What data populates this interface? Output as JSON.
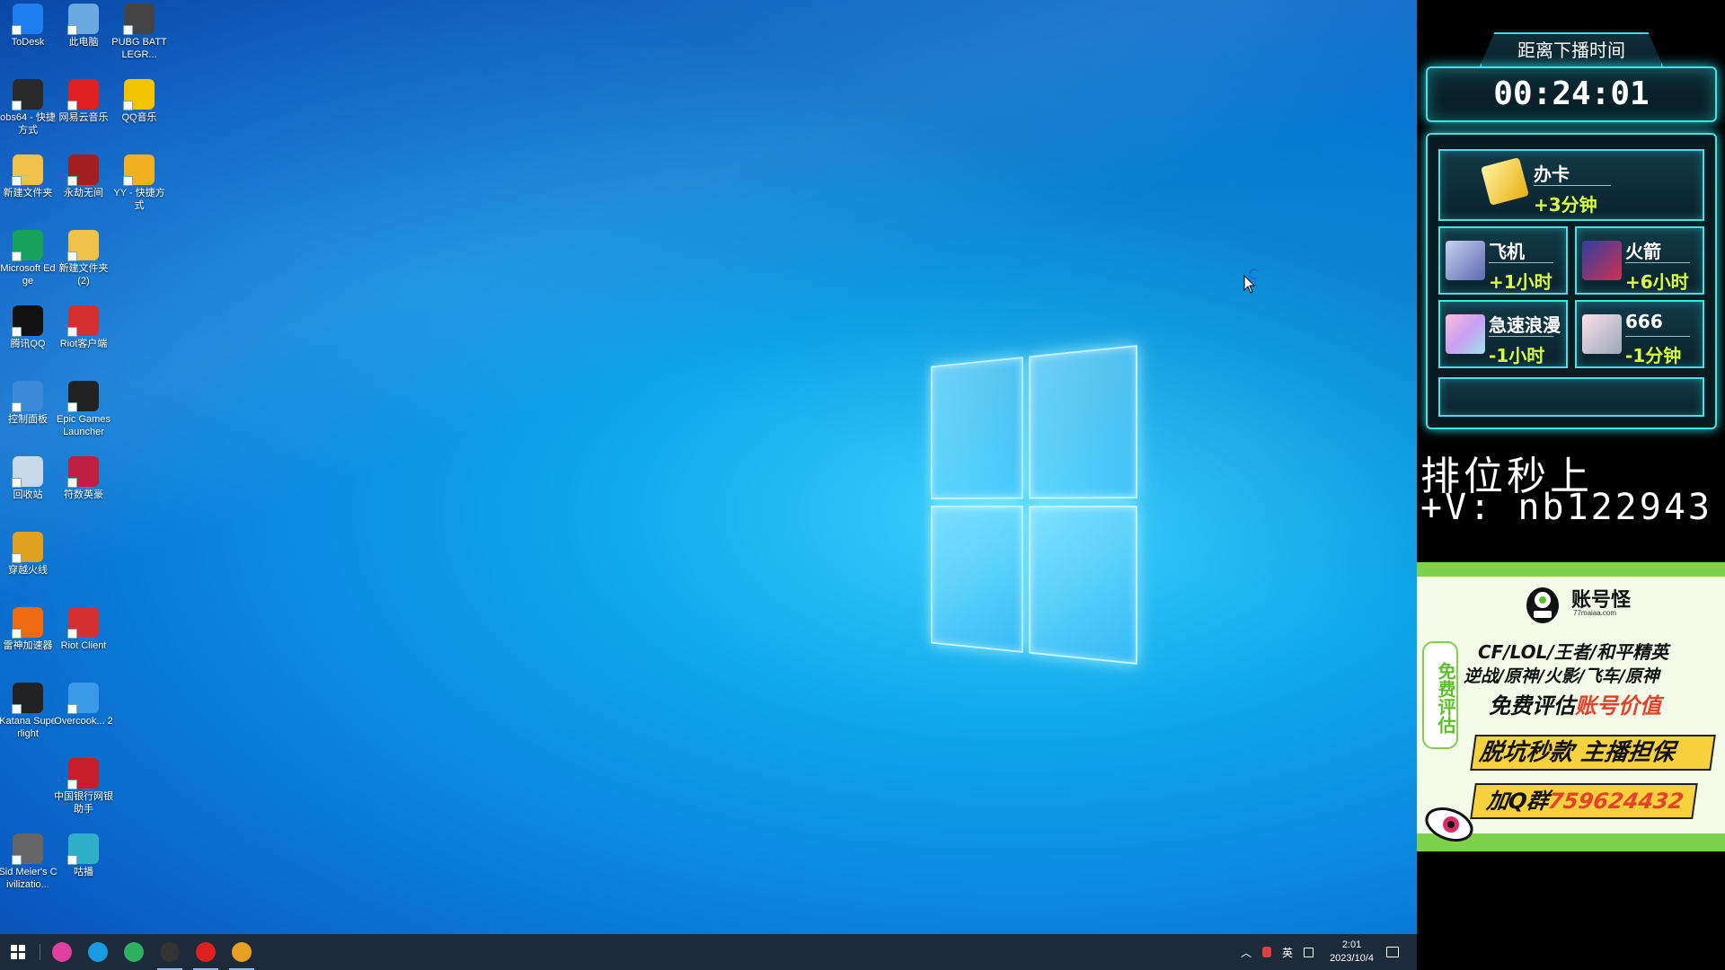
{
  "desktop": {
    "icons": [
      {
        "label": "ToDesk",
        "color": "#1e7ef0"
      },
      {
        "label": "此电脑",
        "color": "#6aa8e0"
      },
      {
        "label": "PUBG BATTLEGR...",
        "color": "#444444"
      },
      {
        "label": "obs64 - 快捷方式",
        "color": "#2a2a2a"
      },
      {
        "label": "网易云音乐",
        "color": "#e02020"
      },
      {
        "label": "QQ音乐",
        "color": "#f5c400"
      },
      {
        "label": "新建文件夹",
        "color": "#f0c24a"
      },
      {
        "label": "永劫无间",
        "color": "#a02020"
      },
      {
        "label": "YY - 快捷方式",
        "color": "#f0b020"
      },
      {
        "label": "Microsoft Edge",
        "color": "#19a35a"
      },
      {
        "label": "新建文件夹 (2)",
        "color": "#f0c24a"
      },
      {
        "label": "腾讯QQ",
        "color": "#111111"
      },
      {
        "label": "Riot客户端",
        "color": "#d43030"
      },
      {
        "label": "控制面板",
        "color": "#3a8ad8"
      },
      {
        "label": "Epic Games Launcher",
        "color": "#222222"
      },
      {
        "label": "回收站",
        "color": "#c8d8e8"
      },
      {
        "label": "符数英豪",
        "color": "#c02040"
      },
      {
        "label": "穿越火线",
        "color": "#e0a020"
      },
      {
        "label": "雷神加速器",
        "color": "#f06a10"
      },
      {
        "label": "Riot Client",
        "color": "#d43030"
      },
      {
        "label": "Katana Superlight",
        "color": "#222222"
      },
      {
        "label": "Overcook... 2",
        "color": "#3a9ae8"
      },
      {
        "label": "中国银行网银助手",
        "color": "#c81e2a"
      },
      {
        "label": "Sid Meier's Civilizatio...",
        "color": "#666666"
      },
      {
        "label": "咕播",
        "color": "#30b0c8"
      }
    ]
  },
  "taskbar": {
    "apps": [
      {
        "name": "color-circle-app-icon",
        "color": "#e040a0"
      },
      {
        "name": "edge-icon",
        "color": "#1a9ae0"
      },
      {
        "name": "nb-app-icon",
        "color": "#2fb060"
      },
      {
        "name": "obs-icon",
        "color": "#333333"
      },
      {
        "name": "netease-music-icon",
        "color": "#e02020"
      },
      {
        "name": "g-app-icon",
        "color": "#e8a020"
      }
    ],
    "tray": {
      "ime": "英",
      "time": "2:01",
      "date": "2023/10/4"
    }
  },
  "overlay": {
    "timer_title": "距离下播时间",
    "timer_value": "00:24:01",
    "gifts": [
      {
        "name": "办卡",
        "value": "+3分钟",
        "color": "#e8c020"
      },
      {
        "name": "飞机",
        "value": "+1小时",
        "color": "#6a7ac8"
      },
      {
        "name": "火箭",
        "value": "+6小时",
        "color": "#c03050"
      },
      {
        "name": "急速浪漫",
        "value": "-1小时",
        "color": "#e090d0"
      },
      {
        "name": "666",
        "value": "-1分钟",
        "color": "#e88aa8"
      }
    ],
    "promo_line1": "排位秒上",
    "promo_line2": "+V: nb122943",
    "ad": {
      "brand": "账号怪",
      "brand_sub": "77maiaa.com",
      "tag": "免费评估",
      "line1": "CF/LOL/王者/和平精英",
      "line2": "逆战/原神/火影/飞车/原神",
      "line3_a": "免费评估",
      "line3_b": "账号价值",
      "ribbon1": "脱坑秒款 主播担保",
      "ribbon2_a": "加Q群",
      "ribbon2_b": "759624432"
    }
  },
  "colors": {
    "accent_cyan": "#3fe3e8",
    "gift_value": "#d8ff3a",
    "ad_green": "#7ed14b",
    "ad_red": "#e8402a",
    "ad_yellow": "#f7d23e"
  }
}
